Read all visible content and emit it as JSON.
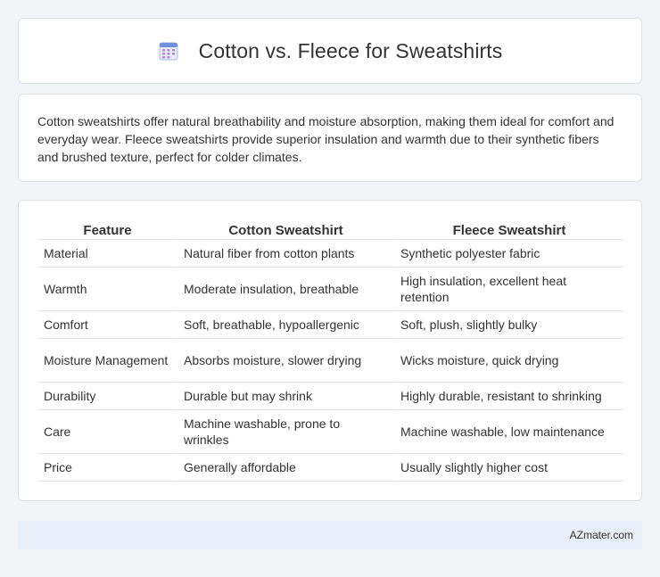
{
  "header": {
    "title": "Cotton vs. Fleece for Sweatshirts",
    "icon": "calendar-icon",
    "icon_colors": {
      "top": "#6f8fe0",
      "body": "#e9ecfb",
      "dots": "#b185e0"
    }
  },
  "intro": {
    "text": "Cotton sweatshirts offer natural breathability and moisture absorption, making them ideal for comfort and everyday wear. Fleece sweatshirts provide superior insulation and warmth due to their synthetic fibers and brushed texture, perfect for colder climates."
  },
  "table": {
    "headers": [
      "Feature",
      "Cotton Sweatshirt",
      "Fleece Sweatshirt"
    ],
    "rows": [
      [
        "Material",
        "Natural fiber from cotton plants",
        "Synthetic polyester fabric"
      ],
      [
        "Warmth",
        "Moderate insulation, breathable",
        "High insulation, excellent heat retention"
      ],
      [
        "Comfort",
        "Soft, breathable, hypoallergenic",
        "Soft, plush, slightly bulky"
      ],
      [
        "Moisture Management",
        "Absorbs moisture, slower drying",
        "Wicks moisture, quick drying"
      ],
      [
        "Durability",
        "Durable but may shrink",
        "Highly durable, resistant to shrinking"
      ],
      [
        "Care",
        "Machine washable, prone to wrinkles",
        "Machine washable, low maintenance"
      ],
      [
        "Price",
        "Generally affordable",
        "Usually slightly higher cost"
      ]
    ]
  },
  "footer": {
    "text": "AZmater.com"
  }
}
